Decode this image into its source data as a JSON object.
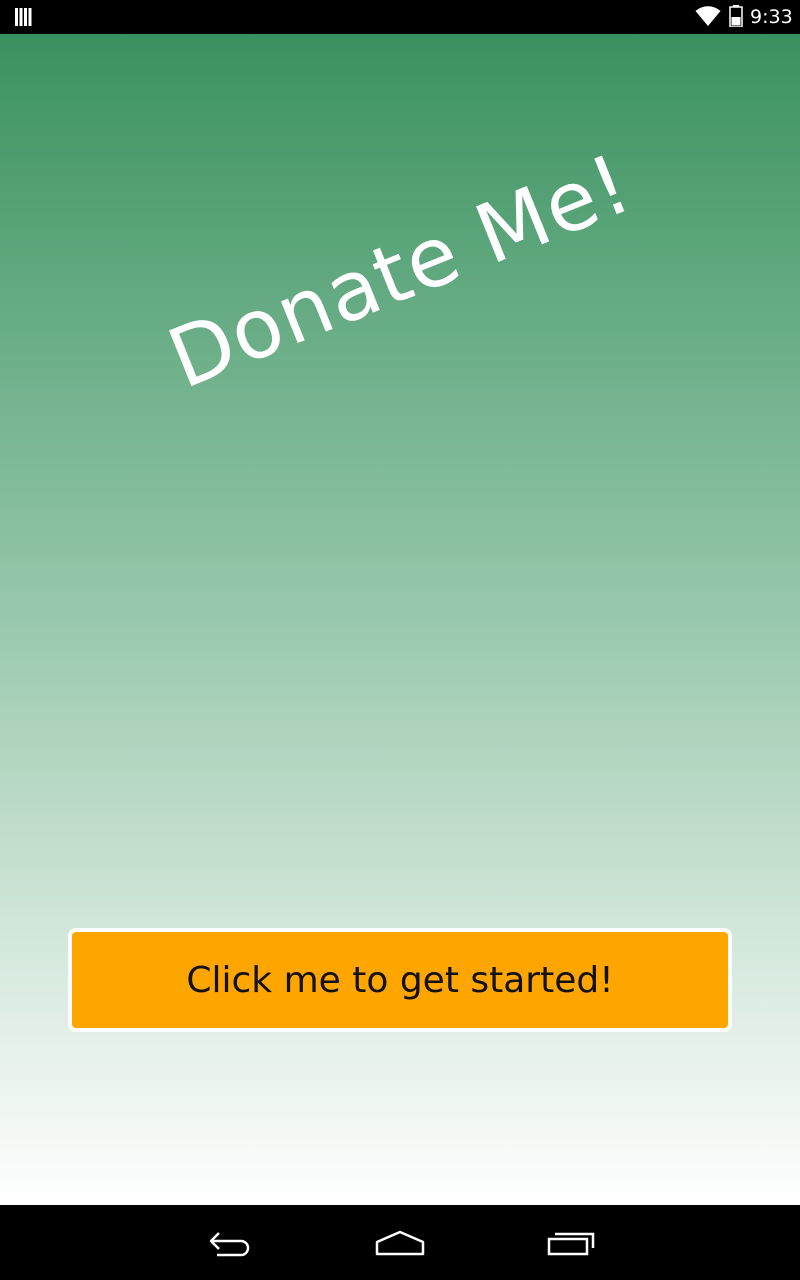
{
  "status_bar": {
    "time": "9:33",
    "icons": [
      "notification-icon",
      "wifi-icon",
      "battery-icon"
    ]
  },
  "main": {
    "headline": "Donate Me!",
    "cta_label": "Click me to get started!"
  },
  "nav_bar": {
    "buttons": [
      "back-icon",
      "home-icon",
      "recents-icon"
    ]
  },
  "colors": {
    "gradient_top": "#3a9160",
    "gradient_bottom": "#ffffff",
    "button_fill": "#ffa500",
    "button_border": "#ffffff",
    "headline_text": "#ffffff"
  }
}
